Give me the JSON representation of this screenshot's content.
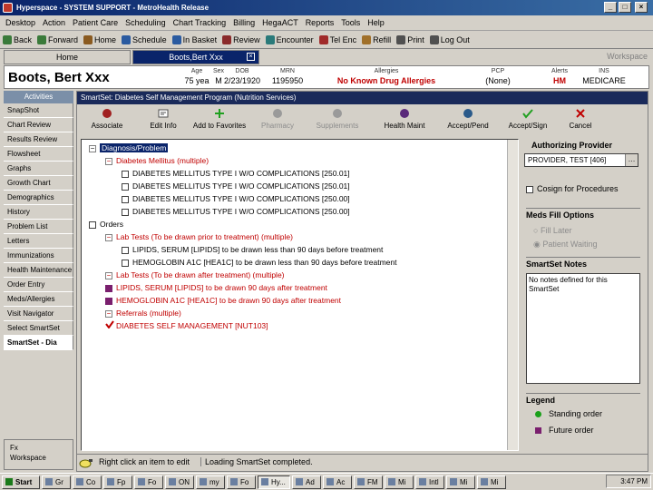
{
  "window": {
    "title": "Hyperspace - SYSTEM SUPPORT - MetroHealth Release"
  },
  "menu": [
    "Desktop",
    "Action",
    "Patient Care",
    "Scheduling",
    "Chart Tracking",
    "Billing",
    "HegaACT",
    "Reports",
    "Tools",
    "Help"
  ],
  "toolbar": [
    {
      "label": "Back",
      "icon": "back-arrow-icon"
    },
    {
      "label": "Forward",
      "icon": "forward-arrow-icon"
    },
    {
      "label": "Home",
      "icon": "home-icon"
    },
    {
      "label": "Schedule",
      "icon": "schedule-icon"
    },
    {
      "label": "In Basket",
      "icon": "inbasket-icon"
    },
    {
      "label": "Review",
      "icon": "review-icon"
    },
    {
      "label": "Encounter",
      "icon": "encounter-icon"
    },
    {
      "label": "Tel Enc",
      "icon": "phone-icon"
    },
    {
      "label": "Refill",
      "icon": "refill-icon"
    },
    {
      "label": "Print",
      "icon": "print-icon"
    },
    {
      "label": "Log Out",
      "icon": "logout-icon"
    }
  ],
  "tabs": {
    "home": "Home",
    "patient": "Boots,Bert Xxx",
    "workspace": "Workspace"
  },
  "patient": {
    "name": "Boots, Bert Xxx",
    "headers": [
      {
        "label": "Age",
        "value": "75 yea"
      },
      {
        "label": "Sex",
        "value": "M"
      },
      {
        "label": "DOB",
        "value": "2/23/1920"
      },
      {
        "label": "MRN",
        "value": "1195950"
      },
      {
        "label": "Allergies",
        "value": "No Known Drug Allergies"
      },
      {
        "label": "PCP",
        "value": "(None)"
      },
      {
        "label": "Alerts",
        "value": "HM"
      },
      {
        "label": "INS",
        "value": "MEDICARE"
      }
    ]
  },
  "sidebar": {
    "heading": "Activities",
    "items": [
      "SnapShot",
      "Chart Review",
      "Results Review",
      "Flowsheet",
      "Graphs",
      "Growth Chart",
      "Demographics",
      "History",
      "Problem List",
      "Letters",
      "Immunizations",
      "Health Maintenance",
      "Order Entry",
      "Meds/Allergies",
      "Visit Navigator",
      "Select SmartSet",
      "SmartSet - Dia"
    ],
    "footer": [
      "Fx",
      "Workspace"
    ]
  },
  "smartset": {
    "title": "SmartSet: Diabetes Self Management Program (Nutrition Services)",
    "actions": [
      {
        "label": "Associate",
        "icon": "associate-icon",
        "enabled": true
      },
      {
        "label": "Edit Info",
        "icon": "edit-icon",
        "enabled": true
      },
      {
        "label": "Add to Favorites",
        "icon": "add-icon",
        "enabled": true
      },
      {
        "label": "Pharmacy",
        "icon": "pharmacy-icon",
        "enabled": false
      },
      {
        "label": "Supplements",
        "icon": "supplements-icon",
        "enabled": false
      },
      {
        "label": "Health Maint",
        "icon": "health-maint-icon",
        "enabled": true
      },
      {
        "label": "Accept/Pend",
        "icon": "accept-pend-icon",
        "enabled": true
      },
      {
        "label": "Accept/Sign",
        "icon": "accept-sign-icon",
        "enabled": true
      },
      {
        "label": "Cancel",
        "icon": "cancel-icon",
        "enabled": true
      }
    ],
    "tree": [
      {
        "text": "Diagnosis/Problem",
        "kind": "expander",
        "sign": "−",
        "indent": 0,
        "style": "normal",
        "selected": true
      },
      {
        "text": "Diabetes Mellitus   (multiple)",
        "kind": "expander",
        "sign": "−",
        "indent": 1,
        "style": "red"
      },
      {
        "text": "DIABETES MELLITUS TYPE I W/O COMPLICATIONS [250.01]",
        "kind": "check",
        "checked": false,
        "indent": 2,
        "style": "normal"
      },
      {
        "text": "DIABETES MELLITUS TYPE I W/O COMPLICATIONS [250.01]",
        "kind": "check",
        "checked": false,
        "indent": 2,
        "style": "normal"
      },
      {
        "text": "DIABETES MELLITUS TYPE I W/O COMPLICATIONS [250.00]",
        "kind": "check",
        "checked": false,
        "indent": 2,
        "style": "normal"
      },
      {
        "text": "DIABETES MELLITUS TYPE I W/O COMPLICATIONS [250.00]",
        "kind": "check",
        "checked": false,
        "indent": 2,
        "style": "normal"
      },
      {
        "text": "Orders",
        "kind": "check",
        "checked": false,
        "indent": 0,
        "style": "normal"
      },
      {
        "text": "Lab Tests  (To be drawn prior to treatment)    (multiple)",
        "kind": "expander",
        "sign": "−",
        "indent": 1,
        "style": "red"
      },
      {
        "text": "LIPIDS, SERUM [LIPIDS] to be drawn less than 90 days before treatment",
        "kind": "check",
        "checked": false,
        "indent": 2,
        "style": "normal"
      },
      {
        "text": "HEMOGLOBIN A1C [HEA1C] to be drawn less than 90 days before treatment",
        "kind": "check",
        "checked": false,
        "indent": 2,
        "style": "normal"
      },
      {
        "text": "Lab Tests  (To be drawn after treatment)    (multiple)",
        "kind": "expander",
        "sign": "−",
        "indent": 1,
        "style": "red"
      },
      {
        "text": "LIPIDS, SERUM [LIPIDS] to be drawn 90 days after treatment",
        "kind": "check",
        "checked": true,
        "indent": 1,
        "style": "red"
      },
      {
        "text": "HEMOGLOBIN A1C [HEA1C] to be drawn 90 days after treatment",
        "kind": "check",
        "checked": true,
        "indent": 1,
        "style": "red"
      },
      {
        "text": "Referrals   (multiple)",
        "kind": "expander",
        "sign": "−",
        "indent": 1,
        "style": "red"
      },
      {
        "text": "DIABETES SELF MANAGEMENT [NUT103]",
        "kind": "tick",
        "indent": 1,
        "style": "red"
      }
    ]
  },
  "rightpane": {
    "authorizing_title": "Authorizing Provider",
    "provider_value": "PROVIDER, TEST [406]",
    "cosign_label": "Cosign for Procedures",
    "meds_fill_title": "Meds Fill Options",
    "fill_later": "Fill Later",
    "patient_waiting": "Patient Waiting",
    "notes_title": "SmartSet Notes",
    "notes_text": "No notes defined for this SmartSet",
    "legend_title": "Legend",
    "legend": [
      {
        "label": "Standing order",
        "color": "#1aa01a",
        "shape": "circle"
      },
      {
        "label": "Future order",
        "color": "#7a1f6e",
        "shape": "square"
      }
    ]
  },
  "status": {
    "hint": "Right click an item to edit",
    "message": "Loading SmartSet completed."
  },
  "taskbar": {
    "start": "Start",
    "items": [
      "Gr",
      "Co",
      "Fp",
      "Fo",
      "ON",
      "my",
      "Fo",
      "Hy...",
      "Ad",
      "Ac",
      "FM",
      "Mi",
      "Intl",
      "Mi",
      "Mi"
    ],
    "time": "3:47 PM"
  }
}
